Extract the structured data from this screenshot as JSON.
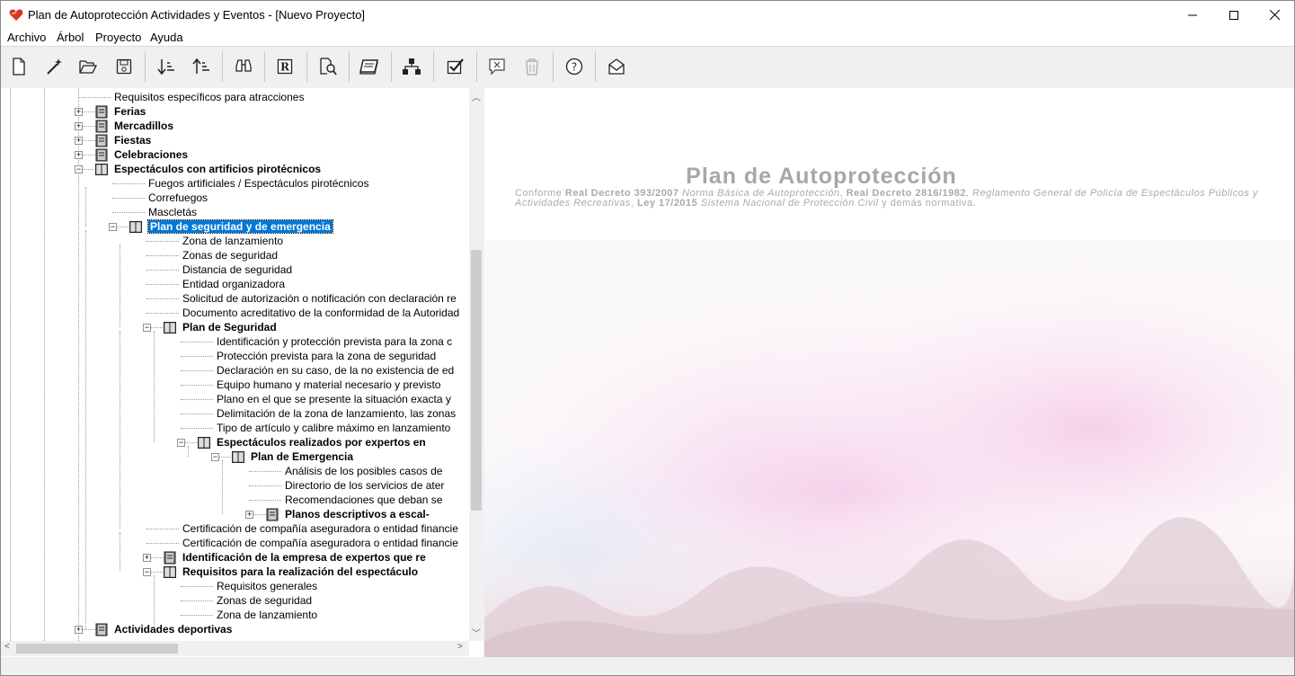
{
  "window": {
    "title": "Plan de Autoprotección Actividades y Eventos - [Nuevo Proyecto]",
    "minimize_glyph": "—",
    "close_glyph": "✕"
  },
  "menu": [
    "Archivo",
    "Árbol",
    "Proyecto",
    "Ayuda"
  ],
  "toolbar": [
    {
      "icon": "new-document-icon"
    },
    {
      "icon": "magic-wand-icon"
    },
    {
      "icon": "open-folder-icon"
    },
    {
      "icon": "save-icon"
    },
    {
      "icon": "sort-descending-icon"
    },
    {
      "icon": "sort-ascending-icon"
    },
    {
      "icon": "binoculars-icon"
    },
    {
      "icon": "registered-icon"
    },
    {
      "icon": "print-preview-icon"
    },
    {
      "icon": "book-icon"
    },
    {
      "icon": "hierarchy-icon"
    },
    {
      "icon": "checkbox-icon"
    },
    {
      "icon": "delete-comment-icon"
    },
    {
      "icon": "trash-icon"
    },
    {
      "icon": "help-icon"
    },
    {
      "icon": "mail-open-icon"
    }
  ],
  "tree": [
    {
      "label": "Requisitos específicos para atracciones",
      "bold": false
    },
    {
      "label": "Ferias",
      "bold": true,
      "expander": "+"
    },
    {
      "label": "Mercadillos",
      "bold": true,
      "expander": "+"
    },
    {
      "label": "Fiestas",
      "bold": true,
      "expander": "+"
    },
    {
      "label": "Celebraciones",
      "bold": true,
      "expander": "+"
    },
    {
      "label": "Espectáculos con artificios pirotécnicos",
      "bold": true,
      "expander": "−"
    },
    {
      "label": "Fuegos artificiales / Espectáculos pirotécnicos",
      "bold": false
    },
    {
      "label": "Correfuegos",
      "bold": false
    },
    {
      "label": "Mascletás",
      "bold": false
    },
    {
      "label": "Plan de seguridad y de emergencia",
      "bold": true,
      "expander": "−",
      "selected": true
    },
    {
      "label": "Zona de lanzamiento",
      "bold": false
    },
    {
      "label": "Zonas de seguridad",
      "bold": false
    },
    {
      "label": "Distancia de seguridad",
      "bold": false
    },
    {
      "label": "Entidad organizadora",
      "bold": false
    },
    {
      "label": "Solicitud de autorización o notificación con declaración re",
      "bold": false
    },
    {
      "label": "Documento acreditativo de la conformidad de la Autoridad",
      "bold": false
    },
    {
      "label": "Plan de Seguridad",
      "bold": true,
      "expander": "−"
    },
    {
      "label": "Identificación y protección prevista para la zona c",
      "bold": false
    },
    {
      "label": "Protección prevista para la zona de seguridad",
      "bold": false
    },
    {
      "label": "Declaración en su caso, de la no existencia de ed",
      "bold": false
    },
    {
      "label": "Equipo humano y material necesario y previsto",
      "bold": false
    },
    {
      "label": "Plano en el que se presente la situación exacta y",
      "bold": false
    },
    {
      "label": "Delimitación de la zona de lanzamiento, las zonas",
      "bold": false
    },
    {
      "label": "Tipo de artículo y calibre máximo en lanzamiento",
      "bold": false
    },
    {
      "label": "Espectáculos realizados por expertos en",
      "bold": true,
      "expander": "−"
    },
    {
      "label": "Plan de Emergencia",
      "bold": true,
      "expander": "−"
    },
    {
      "label": "Análisis de los posibles casos de",
      "bold": false
    },
    {
      "label": "Directorio de los servicios de ater",
      "bold": false
    },
    {
      "label": "Recomendaciones que deban se",
      "bold": false
    },
    {
      "label": "Planos descriptivos a escal-",
      "bold": true,
      "expander": "+"
    },
    {
      "label": "Certificación de compañía aseguradora o entidad financie",
      "bold": false
    },
    {
      "label": "Certificación de compañía aseguradora o entidad financie",
      "bold": false
    },
    {
      "label": "Identificación de la empresa de expertos que re",
      "bold": true,
      "expander": "+"
    },
    {
      "label": "Requisitos para la realización del espectáculo",
      "bold": true,
      "expander": "−"
    },
    {
      "label": "Requisitos generales",
      "bold": false
    },
    {
      "label": "Zonas de seguridad",
      "bold": false
    },
    {
      "label": "Zona de lanzamiento",
      "bold": false
    },
    {
      "label": "Actividades deportivas",
      "bold": true,
      "expander": "+"
    }
  ],
  "document": {
    "title": "Plan de Autoprotección",
    "subtitle_parts": [
      {
        "text": "Conforme ",
        "style": "plain"
      },
      {
        "text": "Real Decreto 393/2007",
        "style": "bold"
      },
      {
        "text": " Norma Básica de Autoprotección",
        "style": "italic"
      },
      {
        "text": ", ",
        "style": "plain"
      },
      {
        "text": "Real Decreto 2816/1982",
        "style": "bold"
      },
      {
        "text": ", Reglamento General de Policía de Espectáculos Públicos y Actividades Recreativas",
        "style": "italic"
      },
      {
        "text": ", ",
        "style": "plain"
      },
      {
        "text": "Ley 17/2015",
        "style": "bold"
      },
      {
        "text": " Sistema Nacional de Protección Civil",
        "style": "italic"
      },
      {
        "text": " y demás normativa.",
        "style": "plain"
      }
    ]
  },
  "colors": {
    "selection": "#0078d7",
    "doc_text": "#a7a7a7"
  }
}
